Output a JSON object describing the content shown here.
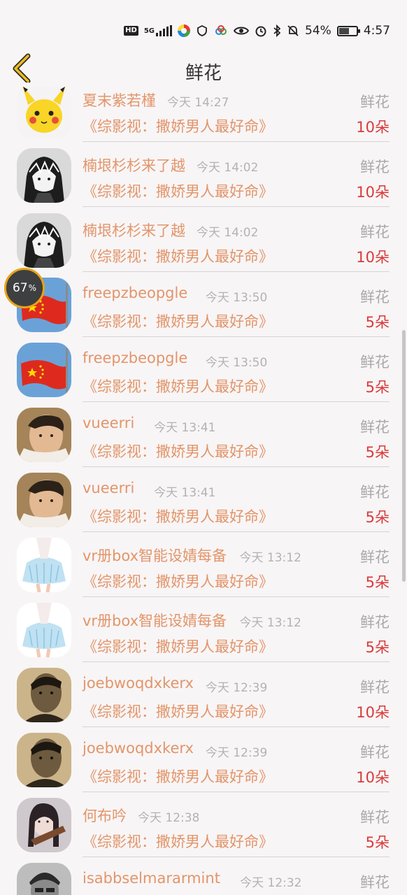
{
  "status_bar": {
    "network": "5G",
    "battery": "54%",
    "time": "4:57"
  },
  "header": {
    "title": "鲜花"
  },
  "floating_badge": {
    "value": "67",
    "unit": "%"
  },
  "list": [
    {
      "name": "夏末紫若槿",
      "time": "今天 14:27",
      "kind": "鲜花",
      "book": "《综影视：撒娇男人最好命》",
      "amount": "10朵",
      "avatar": "pikachu-avatar"
    },
    {
      "name": "楠垠杉杉来了越",
      "time": "今天 14:02",
      "kind": "鲜花",
      "book": "《综影视：撒娇男人最好命》",
      "amount": "10朵",
      "avatar": "anime-manga-avatar"
    },
    {
      "name": "楠垠杉杉来了越",
      "time": "今天 14:02",
      "kind": "鲜花",
      "book": "《综影视：撒娇男人最好命》",
      "amount": "10朵",
      "avatar": "anime-manga-avatar"
    },
    {
      "name": "freepzbeopgle",
      "time": "今天 13:50",
      "kind": "鲜花",
      "book": "《综影视：撒娇男人最好命》",
      "amount": "5朵",
      "avatar": "flag-avatar"
    },
    {
      "name": "freepzbeopgle",
      "time": "今天 13:50",
      "kind": "鲜花",
      "book": "《综影视：撒娇男人最好命》",
      "amount": "5朵",
      "avatar": "flag-avatar"
    },
    {
      "name": "vueerri",
      "time": "今天 13:41",
      "kind": "鲜花",
      "book": "《综影视：撒娇男人最好命》",
      "amount": "5朵",
      "avatar": "man-portrait-avatar"
    },
    {
      "name": "vueerri",
      "time": "今天 13:41",
      "kind": "鲜花",
      "book": "《综影视：撒娇男人最好命》",
      "amount": "5朵",
      "avatar": "man-portrait-avatar"
    },
    {
      "name": "vr册box智能设婧每备",
      "time": "今天 13:12",
      "kind": "鲜花",
      "book": "《综影视：撒娇男人最好命》",
      "amount": "5朵",
      "avatar": "anime-girl-avatar"
    },
    {
      "name": "vr册box智能设婧每备",
      "time": "今天 13:12",
      "kind": "鲜花",
      "book": "《综影视：撒娇男人最好命》",
      "amount": "5朵",
      "avatar": "anime-girl-avatar"
    },
    {
      "name": "joebwoqdxkerx",
      "time": "今天 12:39",
      "kind": "鲜花",
      "book": "《综影视：撒娇男人最好命》",
      "amount": "10朵",
      "avatar": "sepia-man-avatar"
    },
    {
      "name": "joebwoqdxkerx",
      "time": "今天 12:39",
      "kind": "鲜花",
      "book": "《综影视：撒娇男人最好命》",
      "amount": "10朵",
      "avatar": "sepia-man-avatar"
    },
    {
      "name": "何布吟",
      "time": "今天 12:38",
      "kind": "鲜花",
      "book": "《综影视：撒娇男人最好命》",
      "amount": "5朵",
      "avatar": "woman-violin-avatar"
    },
    {
      "name": "isabbselmararmint",
      "time": "今天 12:32",
      "kind": "鲜花",
      "book": "",
      "amount": "",
      "avatar": "bw-man-avatar"
    }
  ]
}
